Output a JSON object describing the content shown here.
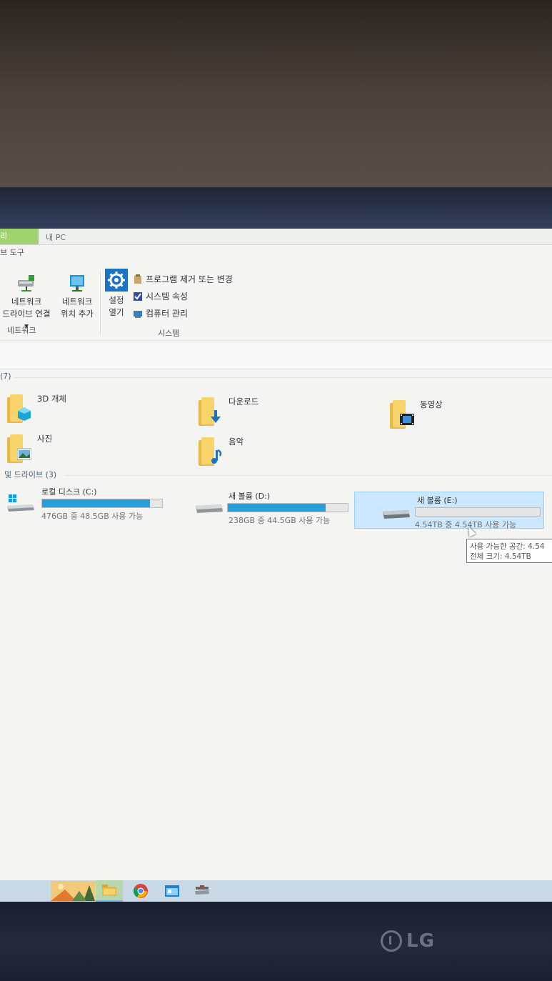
{
  "ribbon_tabs": {
    "manage": "리",
    "this_pc": "내 PC",
    "drive_tools": "브 도구"
  },
  "ribbon": {
    "map_drive": {
      "line1": "네트워크",
      "line2": "드라이브 연결 ▾"
    },
    "add_location": {
      "line1": "네트워크",
      "line2": "위치 추가"
    },
    "network_group": "네트워크",
    "settings": {
      "line1": "설정",
      "line2": "열기"
    },
    "uninstall": "프로그램 제거 또는 변경",
    "system_props": "시스템 속성",
    "manage_pc": "컴퓨터 관리",
    "system_group": "시스템"
  },
  "folders": {
    "header": "(7)",
    "items": [
      {
        "label": "3D 개체",
        "icon": "3d-objects-icon"
      },
      {
        "label": "다운로드",
        "icon": "downloads-icon"
      },
      {
        "label": "동영상",
        "icon": "videos-icon"
      },
      {
        "label": "사진",
        "icon": "pictures-icon"
      },
      {
        "label": "음악",
        "icon": "music-icon"
      }
    ]
  },
  "drives": {
    "header": "및 드라이브 (3)",
    "items": [
      {
        "name": "로컬 디스크 (C:)",
        "free": "476GB 중 48.5GB 사용 가능",
        "used_fraction": 0.898
      },
      {
        "name": "새 볼륨 (D:)",
        "free": "238GB 중 44.5GB 사용 가능",
        "used_fraction": 0.813
      },
      {
        "name": "새 볼륨 (E:)",
        "free": "4.54TB 중 4.54TB 사용 가능",
        "used_fraction": 0.0
      }
    ]
  },
  "tooltip": {
    "line1": "사용 가능한 공간: 4.54",
    "line2": "전체 크기: 4.54TB"
  },
  "brand": "LG",
  "colors": {
    "manage_tab": "#9fd36d",
    "usage_bar": "#26a0da",
    "selection": "#cce8ff"
  }
}
